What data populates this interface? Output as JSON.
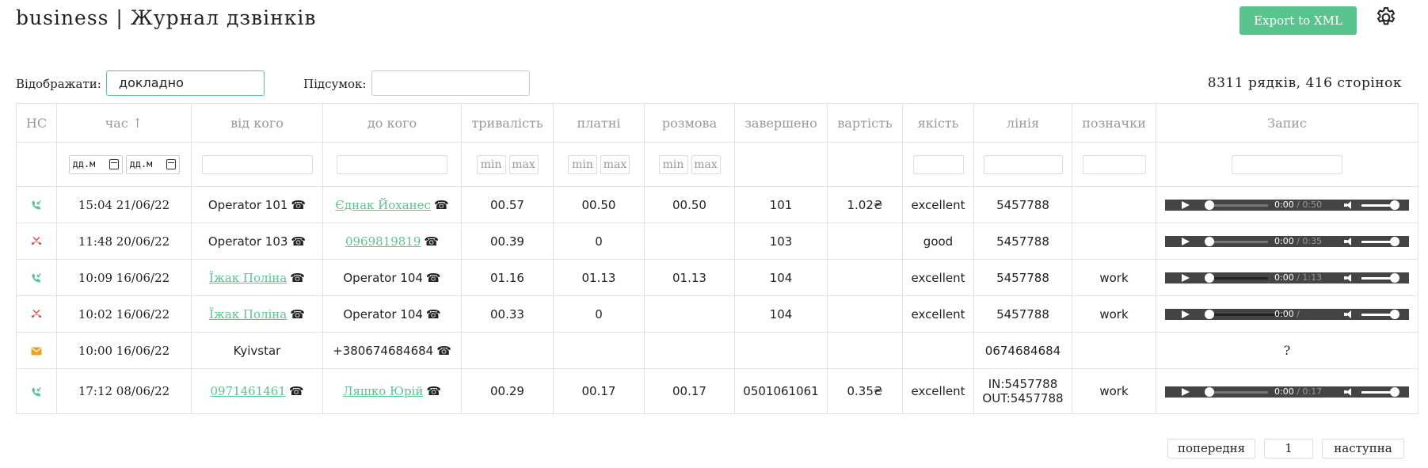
{
  "header": {
    "title": "business | Журнал дзвінків",
    "export_label": "Export to XML"
  },
  "filters": {
    "display_label": "Відображати:",
    "display_value": "докладно",
    "summary_label": "Підсумок:",
    "summary_value": "",
    "rows_info": "8311 рядків, 416 сторінок"
  },
  "table": {
    "headers": [
      "НС",
      "час ↑",
      "від кого",
      "до кого",
      "тривалість",
      "платні",
      "розмова",
      "завершено",
      "вартість",
      "якість",
      "лінія",
      "позначки",
      "Запис"
    ],
    "date_placeholder": "дд.м",
    "min_label": "min",
    "max_label": "max",
    "phone_glyph": "☎",
    "rows": [
      {
        "type": "incoming",
        "time": "15:04 21/06/22",
        "from": "Operator 101",
        "from_link": false,
        "to": "Єднак Йоханес",
        "to_link": true,
        "duration": "00.57",
        "paid": "00.50",
        "talk": "00.50",
        "ended": "101",
        "cost": "1.02₴",
        "quality": "excellent",
        "line": "5457788",
        "line2": "",
        "tag": "",
        "rec_current": "0:00",
        "rec_total": " / 0:50",
        "rec": true
      },
      {
        "type": "missed",
        "time": "11:48 20/06/22",
        "from": "Operator 103",
        "from_link": false,
        "to": "0969819819",
        "to_link": true,
        "duration": "00.39",
        "paid": "0",
        "talk": "",
        "ended": "103",
        "cost": "",
        "quality": "good",
        "line": "5457788",
        "line2": "",
        "tag": "",
        "rec_current": "0:00",
        "rec_total": " / 0:35",
        "rec": true
      },
      {
        "type": "incoming",
        "time": "10:09 16/06/22",
        "from": "Їжак Поліна",
        "from_link": true,
        "to": "Operator 104",
        "to_link": false,
        "duration": "01.16",
        "paid": "01.13",
        "talk": "01.13",
        "ended": "104",
        "cost": "",
        "quality": "excellent",
        "line": "5457788",
        "line2": "",
        "tag": "work",
        "rec_current": "0:00",
        "rec_total": " / 1:13",
        "rec": true
      },
      {
        "type": "missed",
        "time": "10:02 16/06/22",
        "from": "Їжак Поліна",
        "from_link": true,
        "to": "Operator 104",
        "to_link": false,
        "duration": "00.33",
        "paid": "0",
        "talk": "",
        "ended": "104",
        "cost": "",
        "quality": "excellent",
        "line": "5457788",
        "line2": "",
        "tag": "work",
        "rec_current": "0:00",
        "rec_total": " / ",
        "rec": true
      },
      {
        "type": "sms",
        "time": "10:00 16/06/22",
        "from": "Kyivstar",
        "from_link": false,
        "from_phone": false,
        "to": "+380674684684",
        "to_link": false,
        "duration": "",
        "paid": "",
        "talk": "",
        "ended": "",
        "cost": "",
        "quality": "",
        "line": "0674684684",
        "line2": "",
        "tag": "",
        "rec": false,
        "rec_unknown": "?"
      },
      {
        "type": "incoming",
        "time": "17:12 08/06/22",
        "from": "0971461461",
        "from_link": true,
        "to": "Ляшко Юрій",
        "to_link": true,
        "duration": "00.29",
        "paid": "00.17",
        "talk": "00.17",
        "ended": "0501061061",
        "cost": "0.35₴",
        "quality": "excellent",
        "line": "IN:5457788",
        "line2": "OUT:5457788",
        "tag": "work",
        "rec_current": "0:00",
        "rec_total": " / 0:17",
        "rec": true
      }
    ]
  },
  "pager": {
    "prev_label": "попередня",
    "page": "1",
    "next_label": "наступна"
  },
  "colors": {
    "accent": "#5ac48f",
    "missed": "#e04545",
    "sms": "#f0a020"
  }
}
